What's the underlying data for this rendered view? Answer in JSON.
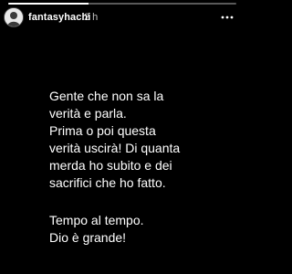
{
  "story": {
    "progress": 0.35,
    "header": {
      "username": "fantasyhachi",
      "time_ago": "2 h",
      "more_icon": "more-horizontal-icon",
      "avatar_icon": "avatar-icon"
    },
    "paragraph_1": "Gente che non sa la\nverità e parla.\nPrima o poi questa\nverità uscirà! Di quanta\nmerda ho subito e dei\nsacrifici che ho fatto.",
    "paragraph_2": "Tempo al tempo.\nDio è grande!"
  },
  "colors": {
    "background": "#000000",
    "text": "#ffffff"
  }
}
